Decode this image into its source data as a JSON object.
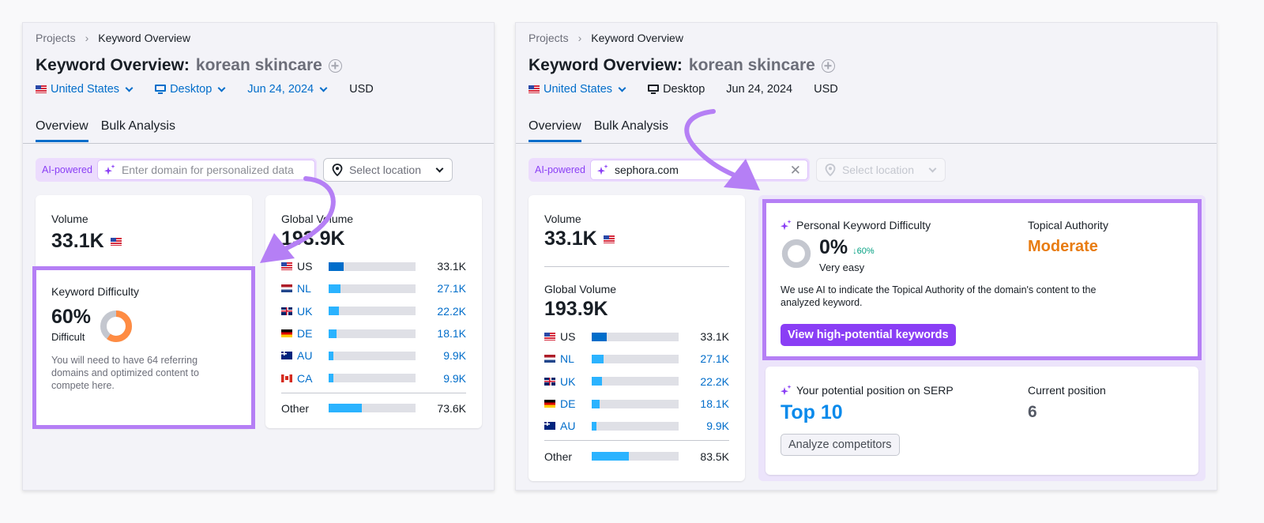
{
  "colors": {
    "link": "#006dca",
    "accent_purple": "#8a3ef5",
    "highlight": "#b57ff5",
    "kd_orange": "#ff8c43",
    "moderate_orange": "#e87c12",
    "top10_blue": "#0a8aeb",
    "delta_green": "#009f81"
  },
  "left": {
    "breadcrumb": {
      "root": "Projects",
      "separator": "›",
      "current": "Keyword Overview"
    },
    "title": {
      "prefix": "Keyword Overview:",
      "keyword": "korean skincare"
    },
    "filters": {
      "country": "United States",
      "device": "Desktop",
      "date": "Jun 24, 2024",
      "currency": "USD"
    },
    "tabs": [
      {
        "label": "Overview",
        "active": true
      },
      {
        "label": "Bulk Analysis",
        "active": false
      }
    ],
    "ai": {
      "badge": "AI-powered",
      "placeholder": "Enter domain for personalized data",
      "location_placeholder": "Select location"
    },
    "volume": {
      "label": "Volume",
      "value": "33.1K"
    },
    "keyword_difficulty": {
      "label": "Keyword Difficulty",
      "value": "60%",
      "percent": 60,
      "level": "Difficult",
      "description": "You will need to have 64 referring domains and optimized content to compete here."
    },
    "global_volume": {
      "label": "Global Volume",
      "value": "193.9K",
      "rows": [
        {
          "code": "US",
          "flag": "us",
          "value": "33.1K",
          "fraction": 0.17,
          "primary": true
        },
        {
          "code": "NL",
          "flag": "nl",
          "value": "27.1K",
          "fraction": 0.14,
          "primary": false
        },
        {
          "code": "UK",
          "flag": "uk",
          "value": "22.2K",
          "fraction": 0.115,
          "primary": false
        },
        {
          "code": "DE",
          "flag": "de",
          "value": "18.1K",
          "fraction": 0.093,
          "primary": false
        },
        {
          "code": "AU",
          "flag": "au",
          "value": "9.9K",
          "fraction": 0.051,
          "primary": false
        },
        {
          "code": "CA",
          "flag": "ca",
          "value": "9.9K",
          "fraction": 0.051,
          "primary": false
        }
      ],
      "other": {
        "label": "Other",
        "value": "73.6K",
        "fraction": 0.38
      }
    }
  },
  "right": {
    "breadcrumb": {
      "root": "Projects",
      "separator": "›",
      "current": "Keyword Overview"
    },
    "title": {
      "prefix": "Keyword Overview:",
      "keyword": "korean skincare"
    },
    "filters": {
      "country": "United States",
      "device": "Desktop",
      "date": "Jun 24, 2024",
      "currency": "USD"
    },
    "tabs": [
      {
        "label": "Overview",
        "active": true
      },
      {
        "label": "Bulk Analysis",
        "active": false
      }
    ],
    "ai": {
      "badge": "AI-powered",
      "value": "sephora.com",
      "location_placeholder": "Select location"
    },
    "volume": {
      "label": "Volume",
      "value": "33.1K"
    },
    "global_volume": {
      "label": "Global Volume",
      "value": "193.9K",
      "rows": [
        {
          "code": "US",
          "flag": "us",
          "value": "33.1K",
          "fraction": 0.17,
          "primary": true
        },
        {
          "code": "NL",
          "flag": "nl",
          "value": "27.1K",
          "fraction": 0.14,
          "primary": false
        },
        {
          "code": "UK",
          "flag": "uk",
          "value": "22.2K",
          "fraction": 0.115,
          "primary": false
        },
        {
          "code": "DE",
          "flag": "de",
          "value": "18.1K",
          "fraction": 0.093,
          "primary": false
        },
        {
          "code": "AU",
          "flag": "au",
          "value": "9.9K",
          "fraction": 0.051,
          "primary": false
        }
      ],
      "other": {
        "label": "Other",
        "value": "83.5K",
        "fraction": 0.43
      }
    },
    "personal_kd": {
      "label": "Personal Keyword Difficulty",
      "value": "0%",
      "percent": 0,
      "delta": "↓60%",
      "level": "Very easy",
      "topical_label": "Topical Authority",
      "topical_value": "Moderate",
      "description": "We use AI to indicate the Topical Authority of the domain's content to the analyzed keyword.",
      "button": "View high-potential keywords"
    },
    "serp": {
      "label": "Your potential position on SERP",
      "value": "Top 10",
      "current_label": "Current position",
      "current_value": "6",
      "button": "Analyze competitors"
    }
  }
}
